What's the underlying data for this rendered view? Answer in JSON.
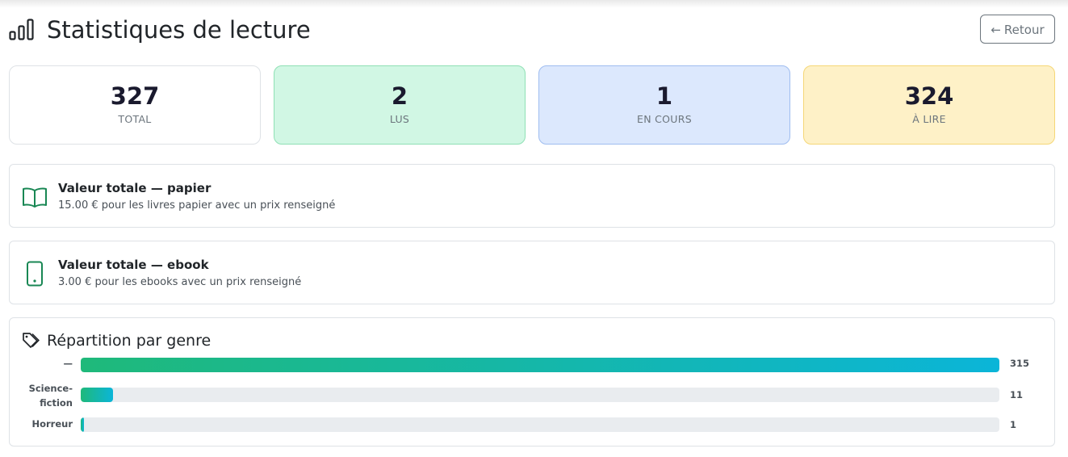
{
  "header": {
    "title": "Statistiques de lecture",
    "title_icon": "bar-chart-icon",
    "back_label": "Retour",
    "back_icon": "arrow-left-icon"
  },
  "stats": [
    {
      "value": "327",
      "label": "TOTAL"
    },
    {
      "value": "2",
      "label": "LUS",
      "color": "#d1f7e4"
    },
    {
      "value": "1",
      "label": "EN COURS",
      "color": "#dce8fd"
    },
    {
      "value": "324",
      "label": "À LIRE",
      "color": "#fef1c7"
    }
  ],
  "values": {
    "paper": {
      "icon": "open-book-icon",
      "title": "Valeur totale — papier",
      "subtitle": "15.00 € pour les livres papier avec un prix renseigné"
    },
    "ebook": {
      "icon": "tablet-icon",
      "title": "Valeur totale — ebook",
      "subtitle": "3.00 € pour les ebooks avec un prix renseigné"
    }
  },
  "genres": {
    "icon": "tags-icon",
    "title": "Répartition par genre",
    "rows": [
      {
        "label": "—",
        "count": "315",
        "value": 315
      },
      {
        "label": "Science-fiction",
        "count": "11",
        "value": 11
      },
      {
        "label": "Horreur",
        "count": "1",
        "value": 1
      }
    ],
    "max": 315
  },
  "colors": {
    "accent_green": "#198754",
    "bar_gradient_start": "#1fb97a",
    "bar_gradient_end": "#0bb5d8"
  }
}
